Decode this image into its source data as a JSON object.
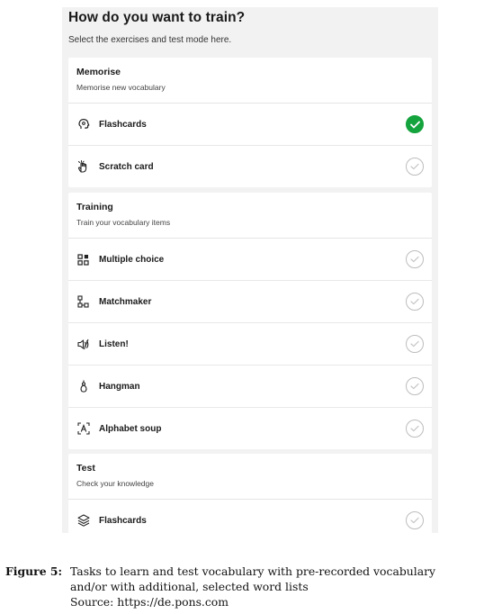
{
  "header": {
    "title": "How do you want to train?",
    "subtitle": "Select the exercises and test mode here."
  },
  "sections": [
    {
      "title": "Memorise",
      "subtitle": "Memorise new vocabulary",
      "items": [
        {
          "label": "Flashcards",
          "icon": "head-icon",
          "selected": true
        },
        {
          "label": "Scratch card",
          "icon": "hand-icon",
          "selected": false
        }
      ]
    },
    {
      "title": "Training",
      "subtitle": "Train your vocabulary items",
      "items": [
        {
          "label": "Multiple choice",
          "icon": "grid-icon",
          "selected": false
        },
        {
          "label": "Matchmaker",
          "icon": "nodes-icon",
          "selected": false
        },
        {
          "label": "Listen!",
          "icon": "sound-icon",
          "selected": false
        },
        {
          "label": "Hangman",
          "icon": "hangman-icon",
          "selected": false
        },
        {
          "label": "Alphabet soup",
          "icon": "letter-a-icon",
          "selected": false
        }
      ]
    },
    {
      "title": "Test",
      "subtitle": "Check your knowledge",
      "items": [
        {
          "label": "Flashcards",
          "icon": "layers-icon",
          "selected": false
        }
      ]
    }
  ],
  "colors": {
    "selected": "#14a33d",
    "unselected": "#bdbdbd"
  },
  "caption": {
    "label": "Figure 5:",
    "line1": "Tasks to learn and test vocabulary with pre-recorded vocabulary",
    "line2": "and/or with additional, selected word lists",
    "line3": "Source: https://de.pons.com"
  }
}
